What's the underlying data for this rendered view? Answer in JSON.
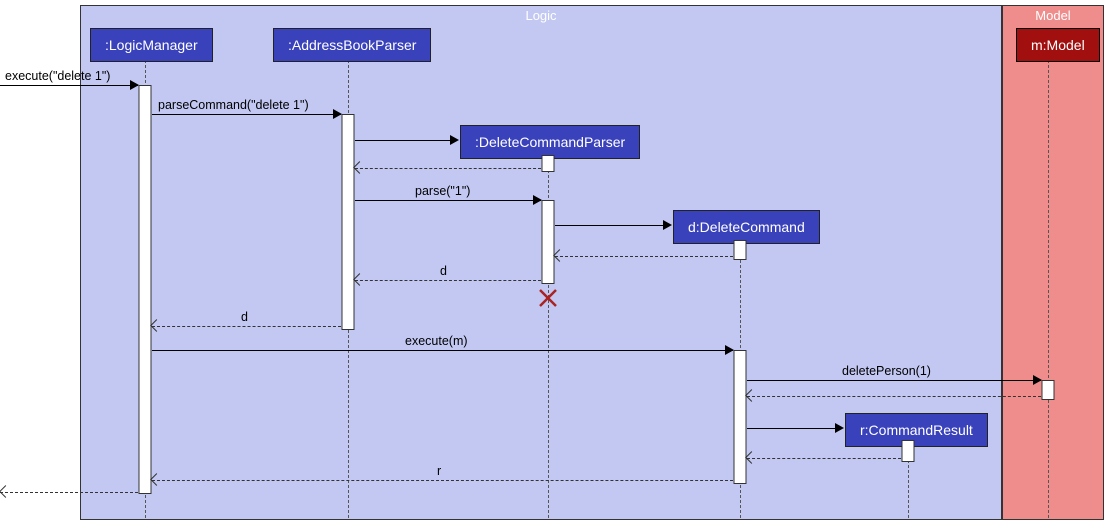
{
  "frames": {
    "logic": "Logic",
    "model": "Model"
  },
  "participants": {
    "logicManager": ":LogicManager",
    "addressBookParser": ":AddressBookParser",
    "deleteCommandParser": ":DeleteCommandParser",
    "deleteCommand": "d:DeleteCommand",
    "commandResult": "r:CommandResult",
    "model": "m:Model"
  },
  "messages": {
    "execute1": "execute(\"delete 1\")",
    "parseCommand": "parseCommand(\"delete 1\")",
    "parse1": "parse(\"1\")",
    "returnD1": "d",
    "returnD2": "d",
    "executeM": "execute(m)",
    "deletePerson": "deletePerson(1)",
    "returnR": "r"
  },
  "chart_data": {
    "type": "sequence-diagram",
    "frames": [
      {
        "name": "Logic",
        "participants": [
          "LogicManager",
          "AddressBookParser",
          "DeleteCommandParser",
          "DeleteCommand",
          "CommandResult"
        ]
      },
      {
        "name": "Model",
        "participants": [
          "Model"
        ]
      }
    ],
    "participants": [
      {
        "id": "LogicManager",
        "label": ":LogicManager"
      },
      {
        "id": "AddressBookParser",
        "label": ":AddressBookParser"
      },
      {
        "id": "DeleteCommandParser",
        "label": ":DeleteCommandParser",
        "created_by": "AddressBookParser",
        "destroyed": true
      },
      {
        "id": "DeleteCommand",
        "label": "d:DeleteCommand",
        "created_by": "DeleteCommandParser"
      },
      {
        "id": "CommandResult",
        "label": "r:CommandResult",
        "created_by": "DeleteCommand"
      },
      {
        "id": "Model",
        "label": "m:Model"
      }
    ],
    "messages": [
      {
        "from": "(external)",
        "to": "LogicManager",
        "label": "execute(\"delete 1\")",
        "type": "call"
      },
      {
        "from": "LogicManager",
        "to": "AddressBookParser",
        "label": "parseCommand(\"delete 1\")",
        "type": "call"
      },
      {
        "from": "AddressBookParser",
        "to": "DeleteCommandParser",
        "label": "",
        "type": "create"
      },
      {
        "from": "DeleteCommandParser",
        "to": "AddressBookParser",
        "label": "",
        "type": "return"
      },
      {
        "from": "AddressBookParser",
        "to": "DeleteCommandParser",
        "label": "parse(\"1\")",
        "type": "call"
      },
      {
        "from": "DeleteCommandParser",
        "to": "DeleteCommand",
        "label": "",
        "type": "create"
      },
      {
        "from": "DeleteCommand",
        "to": "DeleteCommandParser",
        "label": "",
        "type": "return"
      },
      {
        "from": "DeleteCommandParser",
        "to": "AddressBookParser",
        "label": "d",
        "type": "return"
      },
      {
        "from": "DeleteCommandParser",
        "to": "",
        "label": "",
        "type": "destroy"
      },
      {
        "from": "AddressBookParser",
        "to": "LogicManager",
        "label": "d",
        "type": "return"
      },
      {
        "from": "LogicManager",
        "to": "DeleteCommand",
        "label": "execute(m)",
        "type": "call"
      },
      {
        "from": "DeleteCommand",
        "to": "Model",
        "label": "deletePerson(1)",
        "type": "call"
      },
      {
        "from": "Model",
        "to": "DeleteCommand",
        "label": "",
        "type": "return"
      },
      {
        "from": "DeleteCommand",
        "to": "CommandResult",
        "label": "",
        "type": "create"
      },
      {
        "from": "CommandResult",
        "to": "DeleteCommand",
        "label": "",
        "type": "return"
      },
      {
        "from": "DeleteCommand",
        "to": "LogicManager",
        "label": "r",
        "type": "return"
      },
      {
        "from": "LogicManager",
        "to": "(external)",
        "label": "",
        "type": "return"
      }
    ]
  }
}
